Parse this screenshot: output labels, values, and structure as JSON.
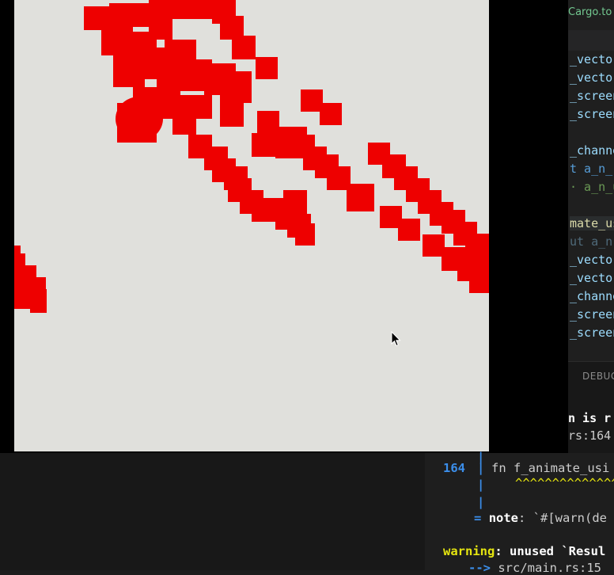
{
  "window": {
    "title": ""
  },
  "canvas": {
    "background": "#e0e0dc",
    "stroke_color": "#ee0000"
  },
  "editor": {
    "tab_label": "Cargo.to",
    "lines": [
      {
        "text": "_vector",
        "cls": "c-var"
      },
      {
        "text": "_vector",
        "cls": "c-var"
      },
      {
        "text": "_screen",
        "cls": "c-var"
      },
      {
        "text": "_screen",
        "cls": "c-var"
      },
      {
        "text": "",
        "cls": "c-var"
      },
      {
        "text": "_channe",
        "cls": "c-var"
      },
      {
        "text": "t a_n_",
        "cls": "c-kw"
      },
      {
        "text": "· a_n_u",
        "cls": "c-green"
      },
      {
        "text": "",
        "cls": "c-var"
      },
      {
        "text": "mate_us",
        "cls": "c-fn"
      },
      {
        "text": "ut a_n",
        "cls": "c-dim"
      },
      {
        "text": "_vector",
        "cls": "c-var"
      },
      {
        "text": "_vector",
        "cls": "c-var"
      },
      {
        "text": "_channe",
        "cls": "c-var"
      },
      {
        "text": "_screen",
        "cls": "c-var"
      },
      {
        "text": "_screen",
        "cls": "c-var"
      }
    ]
  },
  "panel": {
    "title": "DEBUG",
    "line1": "n is r",
    "line2": "rs:164"
  },
  "terminal": {
    "line_fn_num": "164",
    "line_fn_pipe": "|",
    "line_fn_text": "fn f_animate_usi",
    "carets": "^^^^^^^^^^^^^^^^",
    "pipe1": "|",
    "pipe2": "|",
    "pipe3": "|",
    "note_eq": "=",
    "note_word": "note",
    "note_rest": ": `#[warn(de",
    "warning_word": "warning",
    "warning_rest": ": unused `Resul",
    "arrow": "-->",
    "location": "src/main.rs:15"
  }
}
